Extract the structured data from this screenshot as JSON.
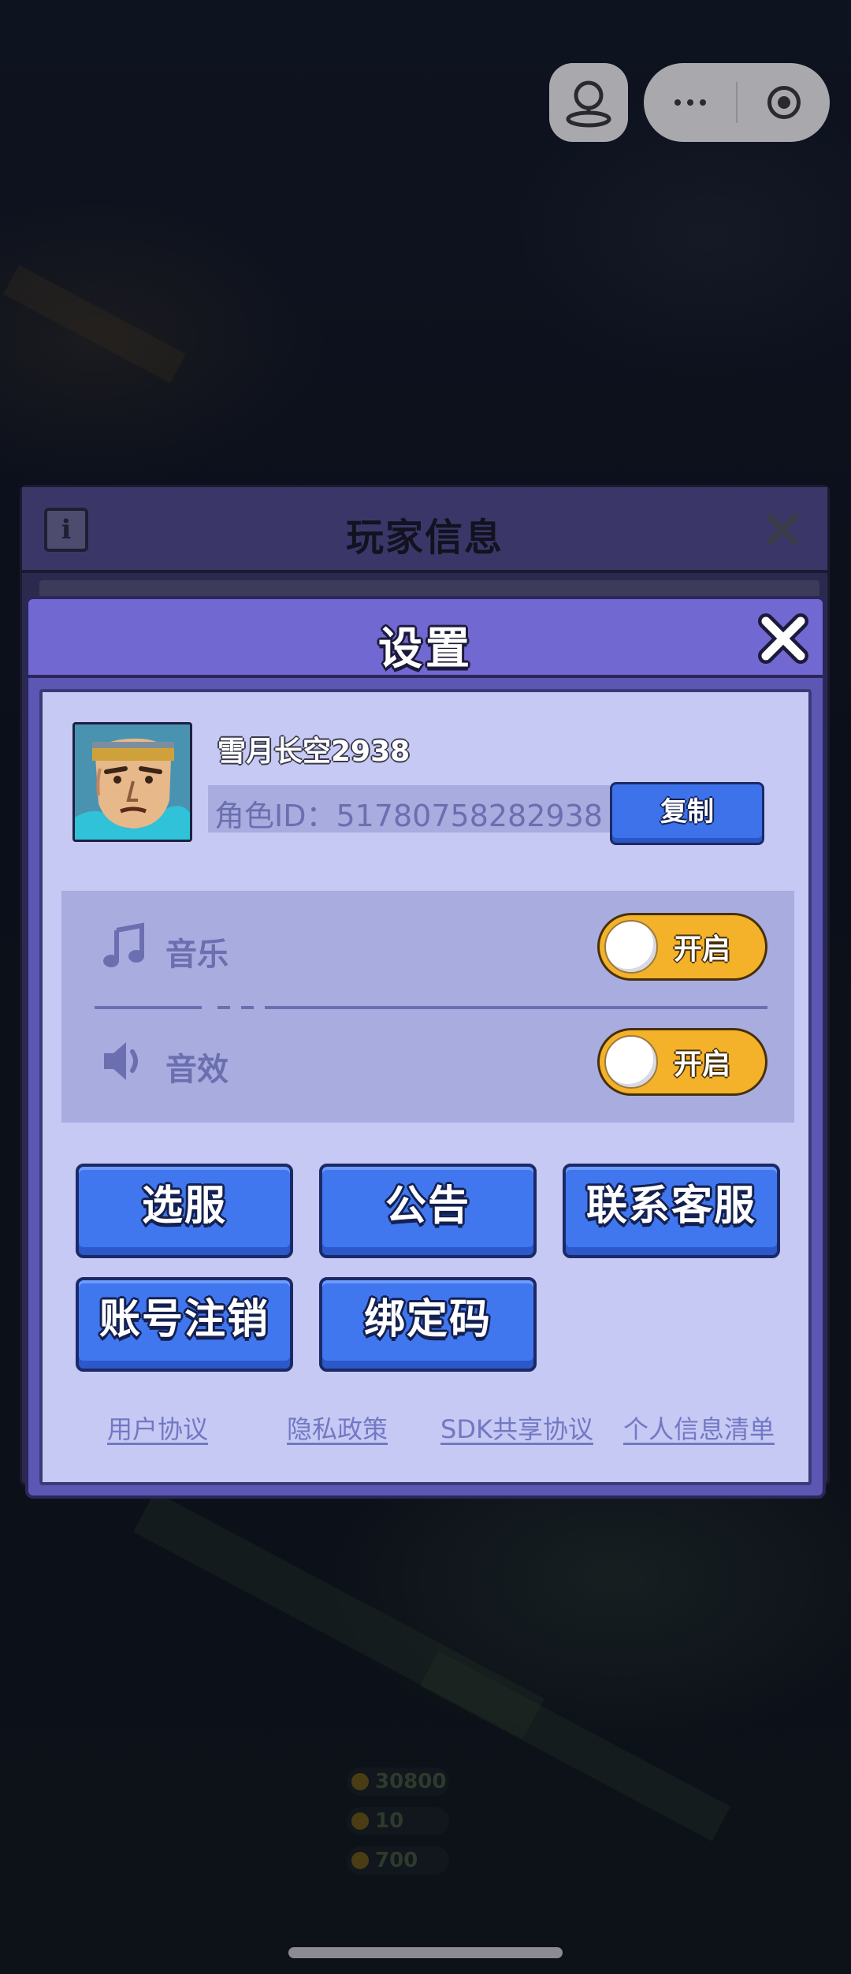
{
  "background_panel": {
    "title": "玩家信息",
    "stats": [
      "30800",
      "10",
      "700"
    ]
  },
  "settings": {
    "title": "设置",
    "player_name": "雪月长空2938",
    "role_id_label": "角色ID：",
    "role_id_value": "51780758282938",
    "copy_label": "复制",
    "music_label": "音乐",
    "music_toggle": "开启",
    "sfx_label": "音效",
    "sfx_toggle": "开启",
    "buttons": {
      "select_server": "选服",
      "announcement": "公告",
      "contact_service": "联系客服",
      "account_cancel": "账号注销",
      "bind_code": "绑定码"
    },
    "links": {
      "user_agreement": "用户协议",
      "privacy_policy": "隐私政策",
      "sdk_sharing": "SDK共享协议",
      "personal_info_list": "个人信息清单"
    }
  },
  "colors": {
    "dialog_header": "#7168d1",
    "dialog_body": "#c6c9f3",
    "button_blue": "#4077ef",
    "toggle_on": "#f4b12a",
    "link": "#7378c4"
  },
  "icons": [
    "info-icon",
    "close-icon",
    "music-note-icon",
    "speaker-icon",
    "more-icon",
    "target-icon",
    "user-icon"
  ]
}
